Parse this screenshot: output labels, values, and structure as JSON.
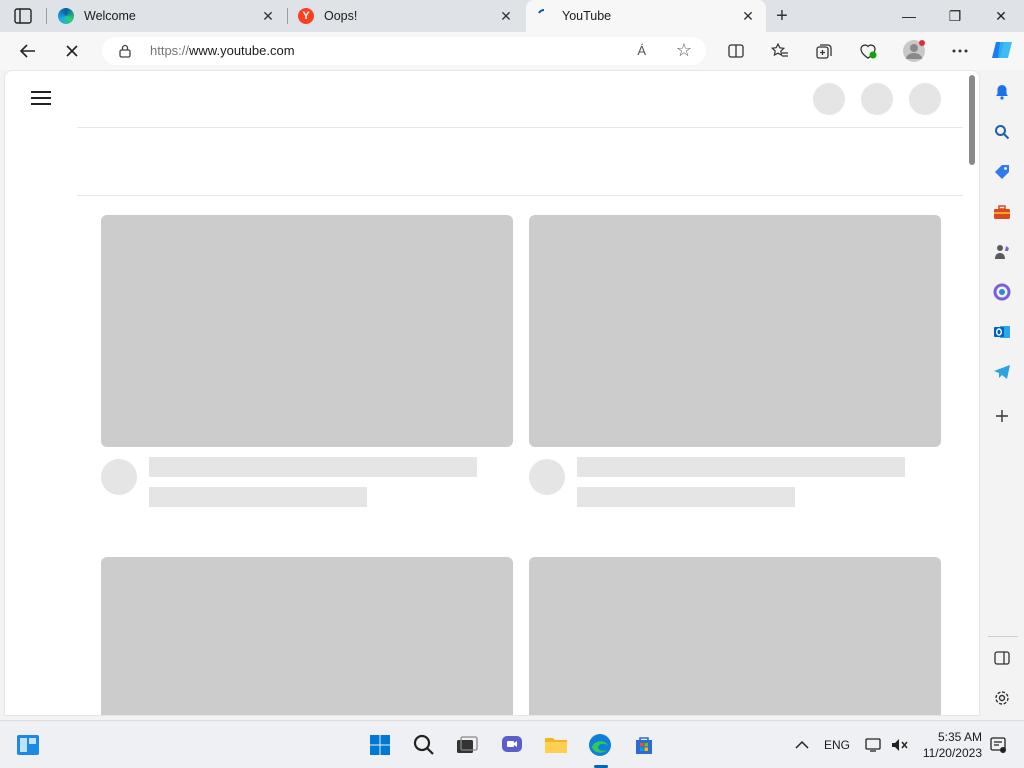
{
  "browser": {
    "tabs": [
      {
        "title": "Welcome",
        "icon": "edge-icon",
        "active": false
      },
      {
        "title": "Oops!",
        "icon": "yandex-icon",
        "active": false
      },
      {
        "title": "YouTube",
        "icon": "loading-icon",
        "active": true
      }
    ],
    "tab_close_glyph": "✕",
    "new_tab_glyph": "+",
    "window_controls": {
      "minimize": "—",
      "restore": "❐",
      "close": "✕"
    },
    "address": {
      "scheme": "https://",
      "host": "www.youtube.com",
      "read_aloud_glyph": "Á"
    }
  },
  "sidebar_icons": [
    "bell-icon",
    "search-icon",
    "shopping-tag-icon",
    "toolbox-icon",
    "games-icon",
    "microsoft-365-icon",
    "outlook-icon",
    "telegram-icon",
    "add-icon",
    "split-screen-icon",
    "settings-icon"
  ],
  "taskbar": {
    "language": "ENG",
    "time": "5:35 AM",
    "date": "11/20/2023"
  },
  "colors": {
    "skeleton_thumb": "#cccccc",
    "skeleton_text": "#e5e5e5",
    "accent": "#0067c0"
  }
}
